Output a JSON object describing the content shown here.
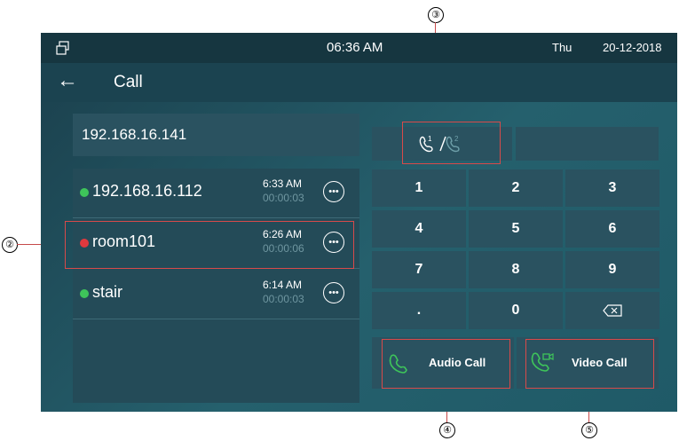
{
  "status_bar": {
    "time": "06:36 AM",
    "day": "Thu",
    "date": "20-12-2018"
  },
  "app_bar": {
    "back_icon": "arrow-left-icon",
    "title": "Call"
  },
  "dial_input": {
    "value": "192.168.16.141"
  },
  "history": [
    {
      "name": "192.168.16.112",
      "time": "6:33 AM",
      "duration": "00:00:03",
      "status": "answered",
      "status_color": "#3ec45a"
    },
    {
      "name": "room101",
      "time": "6:26 AM",
      "duration": "00:00:06",
      "status": "missed",
      "status_color": "#e0393e"
    },
    {
      "name": "stair",
      "time": "6:14 AM",
      "duration": "00:00:03",
      "status": "answered",
      "status_color": "#3ec45a"
    }
  ],
  "line_toggle": {
    "icon": "phone-line-switch-icon",
    "line_a": "1",
    "line_b": "2"
  },
  "keypad": [
    "1",
    "2",
    "3",
    "4",
    "5",
    "6",
    "7",
    "8",
    "9",
    ".",
    "0"
  ],
  "keypad_delete_icon": "backspace-icon",
  "audio_call": {
    "label": "Audio Call",
    "icon": "phone-icon"
  },
  "video_call": {
    "label": "Video Call",
    "icon": "video-phone-icon"
  },
  "callouts": {
    "two": "②",
    "three": "③",
    "four": "④",
    "five": "⑤"
  },
  "colors": {
    "accent_green": "#3ec45a",
    "missed_red": "#e0393e",
    "panel": "#2a5260"
  }
}
